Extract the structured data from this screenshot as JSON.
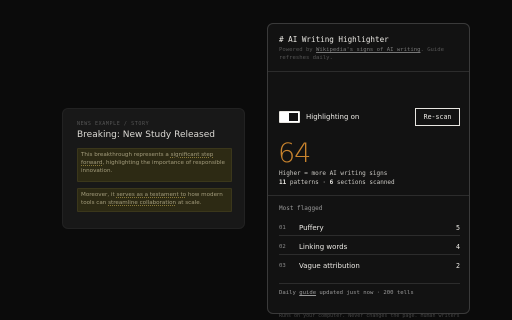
{
  "news": {
    "kicker": "NEWS EXAMPLE / STORY",
    "title": "Breaking: New Study Released",
    "para1": [
      {
        "text": "This breakthrough represents a ",
        "flag": false
      },
      {
        "text": "significant step forward",
        "flag": true
      },
      {
        "text": ", highlighting the importance of responsible innovation.",
        "flag": false
      }
    ],
    "para2": [
      {
        "text": "Moreover, it ",
        "flag": false
      },
      {
        "text": "serves as a testament to",
        "flag": true
      },
      {
        "text": " how modern tools can ",
        "flag": false
      },
      {
        "text": "streamline collaboration",
        "flag": true
      },
      {
        "text": " at scale.",
        "flag": false
      }
    ]
  },
  "panel": {
    "title": "# AI Writing Highlighter",
    "subtitle_pre": "Powered by ",
    "subtitle_link": "Wikipedia's signs of AI writing",
    "subtitle_post": ". Guide refreshes daily.",
    "toggle_label": "Highlighting on",
    "toggle_on": true,
    "rescan_label": "Re-scan",
    "score": "64",
    "score_caption": "Higher = more AI writing signs",
    "patterns_count": "11",
    "patterns_label": "patterns · ",
    "sections_count": "6",
    "sections_label": "sections scanned",
    "flag_heading": "Most flagged",
    "flags": [
      {
        "rank": "01",
        "label": "Puffery",
        "count": "5"
      },
      {
        "rank": "02",
        "label": "Linking words",
        "count": "4"
      },
      {
        "rank": "03",
        "label": "Vague attribution",
        "count": "2"
      }
    ],
    "daily_pre": "Daily ",
    "daily_link": "guide",
    "daily_post": " updated just now · 200 tells",
    "footer": "Runs on your computer. Never changes the page. Human writers trigger these patterns too."
  },
  "colors": {
    "accent": "#c8832d",
    "highlight_bg": "#2d2a14"
  }
}
